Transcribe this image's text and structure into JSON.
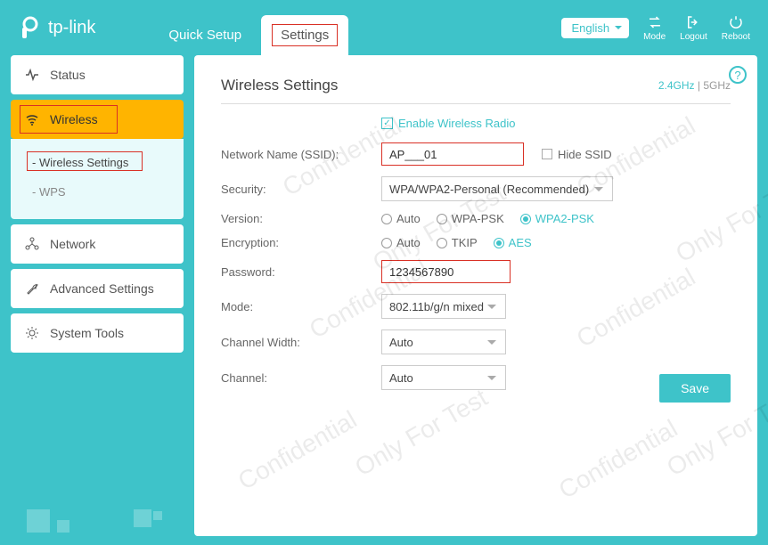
{
  "brand": "tp-link",
  "header": {
    "tabs": {
      "quick_setup": "Quick Setup",
      "settings": "Settings"
    },
    "language": "English",
    "buttons": {
      "mode": "Mode",
      "logout": "Logout",
      "reboot": "Reboot"
    }
  },
  "sidebar": {
    "status": "Status",
    "wireless": "Wireless",
    "wireless_sub": {
      "settings": "- Wireless Settings",
      "wps": "- WPS"
    },
    "network": "Network",
    "advanced": "Advanced Settings",
    "system": "System Tools"
  },
  "main": {
    "title": "Wireless Settings",
    "bands": {
      "g24": "2.4GHz",
      "sep": " | ",
      "g5": "5GHz"
    },
    "enable_label": "Enable Wireless Radio",
    "labels": {
      "ssid": "Network Name (SSID):",
      "security": "Security:",
      "version": "Version:",
      "encryption": "Encryption:",
      "password": "Password:",
      "mode": "Mode:",
      "cwidth": "Channel Width:",
      "channel": "Channel:"
    },
    "values": {
      "ssid": "AP___01",
      "security": "WPA/WPA2-Personal (Recommended)",
      "password": "1234567890",
      "mode": "802.11b/g/n mixed",
      "cwidth": "Auto",
      "channel": "Auto"
    },
    "hide_ssid": "Hide SSID",
    "version_opts": {
      "auto": "Auto",
      "wpapsk": "WPA-PSK",
      "wpa2psk": "WPA2-PSK"
    },
    "encryption_opts": {
      "auto": "Auto",
      "tkip": "TKIP",
      "aes": "AES"
    },
    "save": "Save"
  },
  "watermarks": {
    "c": "Confidential",
    "t": "Only For Test"
  }
}
